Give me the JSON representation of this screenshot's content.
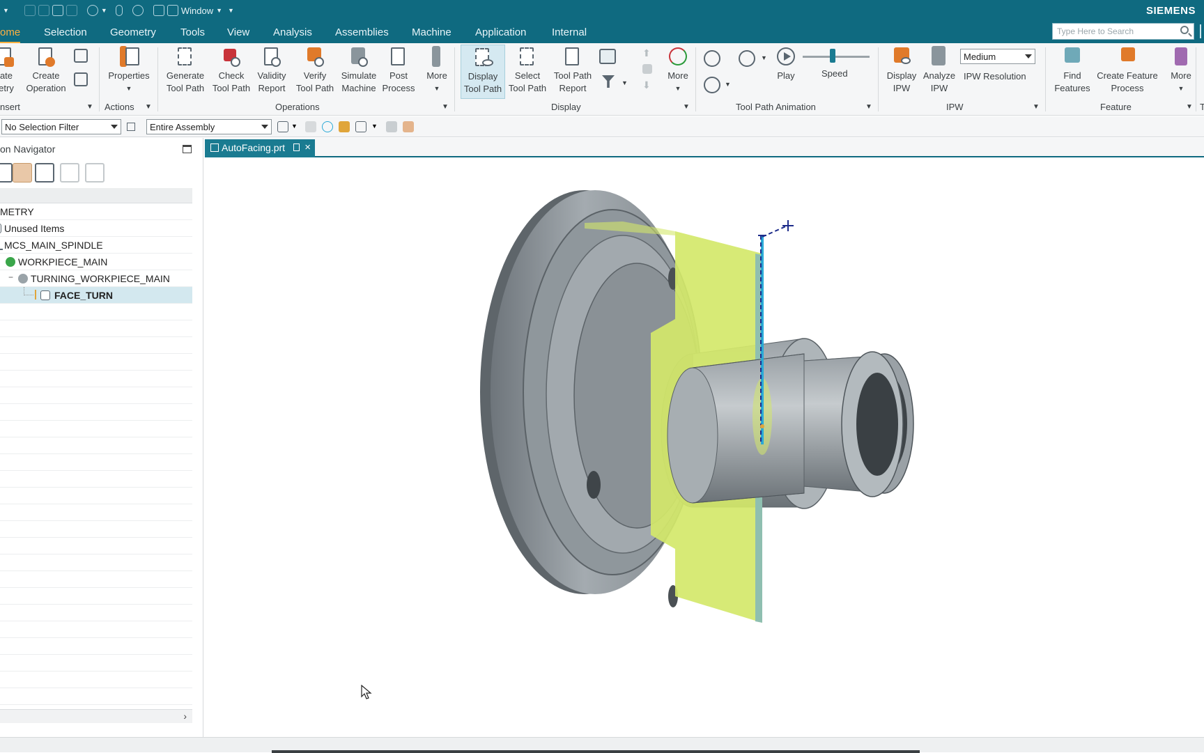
{
  "titlebar": {
    "window_menu": "Window",
    "brand": "SIEMENS"
  },
  "menu": {
    "tabs": [
      {
        "label": "ome",
        "active": true
      },
      {
        "label": "Selection"
      },
      {
        "label": "Geometry"
      },
      {
        "label": "Tools"
      },
      {
        "label": "View"
      },
      {
        "label": "Analysis"
      },
      {
        "label": "Assemblies"
      },
      {
        "label": "Machine"
      },
      {
        "label": "Application"
      },
      {
        "label": "Internal"
      }
    ],
    "search_placeholder": "Type Here to Search"
  },
  "ribbon": {
    "insert": {
      "create_geometry": "ate\netry",
      "create_operation": "Create\nOperation",
      "group_label": "nsert"
    },
    "actions": {
      "properties": "Properties",
      "group_label": "Actions"
    },
    "operations": {
      "generate_tool_path": "Generate\nTool Path",
      "check_tool_path": "Check\nTool Path",
      "validity_report": "Validity\nReport",
      "verify_tool_path": "Verify\nTool Path",
      "simulate_machine": "Simulate\nMachine",
      "post_process": "Post\nProcess",
      "more": "More",
      "group_label": "Operations"
    },
    "display": {
      "display_tool_path": "Display\nTool Path",
      "select_tool_path": "Select\nTool Path",
      "tool_path_report": "Tool Path\nReport",
      "more": "More",
      "group_label": "Display"
    },
    "animation": {
      "play": "Play",
      "speed": "Speed",
      "speed_level": 0.45,
      "group_label": "Tool Path Animation"
    },
    "ipw": {
      "display_ipw": "Display\nIPW",
      "analyze_ipw": "Analyze\nIPW",
      "resolution_value": "Medium",
      "resolution_label": "IPW Resolution",
      "group_label": "IPW"
    },
    "feature": {
      "find_features": "Find\nFeatures",
      "create_feature_process": "Create Feature\nProcess",
      "more": "More",
      "group_label": "Feature",
      "next_group_stub": "T"
    }
  },
  "filterbar": {
    "selection_filter": "No Selection Filter",
    "scope": "Entire Assembly"
  },
  "navigator": {
    "title": "on Navigator",
    "rows": [
      {
        "label": "METRY",
        "indent": 0,
        "icon": "none"
      },
      {
        "label": "Unused Items",
        "indent": 1,
        "icon": "none"
      },
      {
        "label": "MCS_MAIN_SPINDLE",
        "indent": 1,
        "icon": "mcs-icon"
      },
      {
        "label": "WORKPIECE_MAIN",
        "indent": 2,
        "icon": "workpiece-icon"
      },
      {
        "label": "TURNING_WORKPIECE_MAIN",
        "indent": 3,
        "icon": "turning-workpiece-icon"
      },
      {
        "label": "FACE_TURN",
        "indent": 4,
        "icon": "operation-icon",
        "selected": true
      }
    ]
  },
  "document": {
    "tab_label": "AutoFacing.prt"
  },
  "colors": {
    "header": "#0f6a80",
    "accent_tab": "#ffb040",
    "facing_plane": "#d4e86a",
    "toolpath": "#2aa9d6",
    "part": "#8b9298"
  }
}
